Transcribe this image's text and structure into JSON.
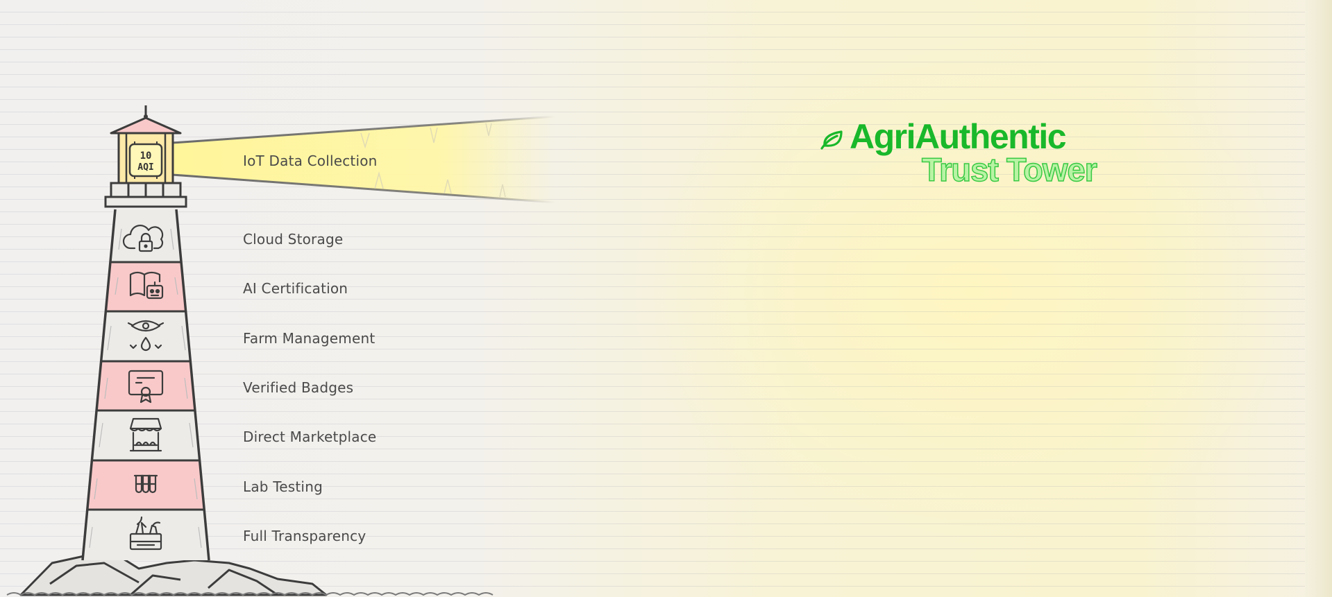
{
  "brand": {
    "name": "AgriAuthentic",
    "subtitle": "Trust Tower",
    "icon": "leaf-icon",
    "color": "#19b82b"
  },
  "lantern": {
    "readout": [
      "10",
      "AQI"
    ]
  },
  "layers": [
    {
      "label": "IoT Data Collection",
      "icon": "aqi-sensor-icon"
    },
    {
      "label": "Cloud Storage",
      "icon": "cloud-lock-icon"
    },
    {
      "label": "AI Certification",
      "icon": "book-robot-icon"
    },
    {
      "label": "Farm Management",
      "icon": "eye-water-icon"
    },
    {
      "label": "Verified Badges",
      "icon": "certificate-icon"
    },
    {
      "label": "Direct Marketplace",
      "icon": "market-stall-icon"
    },
    {
      "label": "Lab Testing",
      "icon": "test-tubes-icon"
    },
    {
      "label": "Full Transparency",
      "icon": "produce-crate-icon"
    }
  ],
  "colors": {
    "stripe_red": "#f9c9c9",
    "stripe_light": "#ecebe8",
    "beam": "#fff6a8",
    "outline": "#3c3c3c"
  }
}
